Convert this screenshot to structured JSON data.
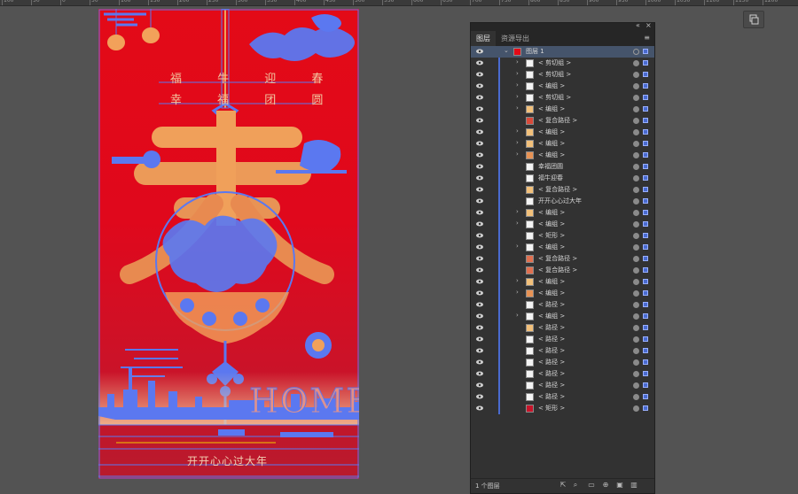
{
  "ruler": {
    "labels": [
      "100",
      "50",
      "0",
      "50",
      "100",
      "150",
      "200",
      "250",
      "300",
      "350",
      "400",
      "450",
      "500",
      "550",
      "600",
      "650",
      "700",
      "750",
      "800",
      "850",
      "900",
      "950",
      "1000",
      "1050",
      "1100",
      "1150",
      "1200",
      "1250"
    ]
  },
  "artboard": {
    "line1": "福 牛 迎 春",
    "line2": "幸 福 团 圆",
    "big_char": "春",
    "home_text": "HOME",
    "footer_text": "开开心心过大年",
    "colors": {
      "bg": "#e30a17",
      "accent": "#f2a15a",
      "selection": "#5b78f0"
    }
  },
  "panel": {
    "tabs": [
      "图层",
      "资源导出"
    ],
    "menu_icon": "hamburger-menu-icon",
    "top_layer": "图层 1",
    "layers": [
      {
        "name": "< 剪切组 >",
        "arrow": true
      },
      {
        "name": "< 剪切组 >",
        "arrow": true
      },
      {
        "name": "< 编组 >",
        "arrow": true
      },
      {
        "name": "< 剪切组 >",
        "arrow": true
      },
      {
        "name": "< 编组 >",
        "arrow": true
      },
      {
        "name": "< 复合路径 >",
        "arrow": false
      },
      {
        "name": "< 编组 >",
        "arrow": true
      },
      {
        "name": "< 编组 >",
        "arrow": true
      },
      {
        "name": "< 编组 >",
        "arrow": true
      },
      {
        "name": "幸福团圆",
        "arrow": false
      },
      {
        "name": "福牛迎春",
        "arrow": false
      },
      {
        "name": "< 复合路径 >",
        "arrow": false
      },
      {
        "name": "开开心心过大年",
        "arrow": false
      },
      {
        "name": "< 编组 >",
        "arrow": true
      },
      {
        "name": "< 编组 >",
        "arrow": true
      },
      {
        "name": "< 矩形 >",
        "arrow": false
      },
      {
        "name": "< 编组 >",
        "arrow": true
      },
      {
        "name": "< 复合路径 >",
        "arrow": false
      },
      {
        "name": "< 复合路径 >",
        "arrow": false
      },
      {
        "name": "< 编组 >",
        "arrow": true
      },
      {
        "name": "< 编组 >",
        "arrow": true
      },
      {
        "name": "< 路径 >",
        "arrow": false
      },
      {
        "name": "< 编组 >",
        "arrow": true
      },
      {
        "name": "< 路径 >",
        "arrow": false
      },
      {
        "name": "< 路径 >",
        "arrow": false
      },
      {
        "name": "< 路径 >",
        "arrow": false
      },
      {
        "name": "< 路径 >",
        "arrow": false
      },
      {
        "name": "< 路径 >",
        "arrow": false
      },
      {
        "name": "< 路径 >",
        "arrow": false
      },
      {
        "name": "< 路径 >",
        "arrow": false
      },
      {
        "name": "< 矩形 >",
        "arrow": false
      }
    ],
    "footer_label": "1 个图层",
    "footer_icons": [
      "export-icon",
      "search-icon",
      "clip-mask-icon",
      "sublayer-icon",
      "new-layer-icon",
      "delete-icon"
    ]
  }
}
